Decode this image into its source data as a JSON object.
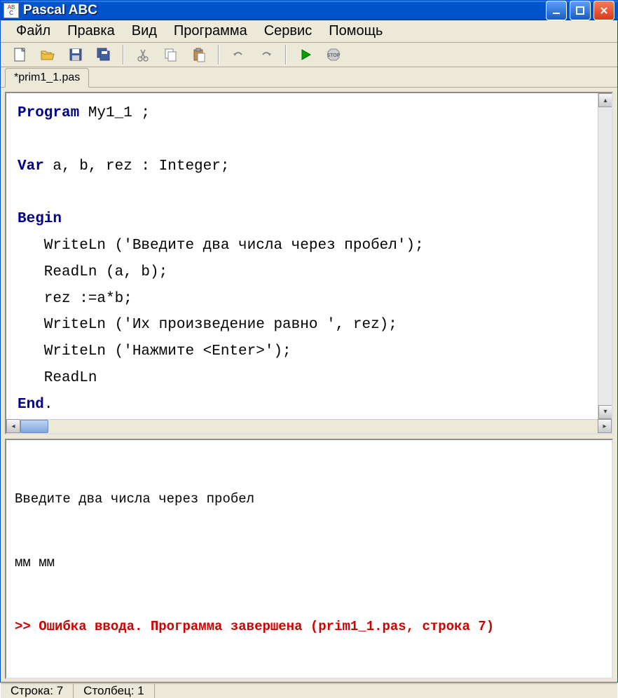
{
  "window": {
    "title": "Pascal ABC"
  },
  "menu": [
    "Файл",
    "Правка",
    "Вид",
    "Программа",
    "Сервис",
    "Помощь"
  ],
  "toolbar_icons": [
    "new-icon",
    "open-icon",
    "save-icon",
    "save-all-icon",
    "cut-icon",
    "copy-icon",
    "paste-icon",
    "undo-icon",
    "redo-icon",
    "run-icon",
    "stop-icon"
  ],
  "tabs": [
    "*prim1_1.pas"
  ],
  "code": {
    "lines": [
      {
        "segments": [
          {
            "t": "Program",
            "c": "kw"
          },
          {
            "t": " My1_1 ;",
            "c": ""
          }
        ]
      },
      {
        "segments": [
          {
            "t": "",
            "c": ""
          }
        ]
      },
      {
        "segments": [
          {
            "t": "Var",
            "c": "kw"
          },
          {
            "t": " a, b, rez : Integer;",
            "c": ""
          }
        ]
      },
      {
        "segments": [
          {
            "t": "",
            "c": ""
          }
        ]
      },
      {
        "segments": [
          {
            "t": "Begin",
            "c": "kw"
          }
        ]
      },
      {
        "segments": [
          {
            "t": "   WriteLn ('Введите два числа через пробел');",
            "c": ""
          }
        ]
      },
      {
        "segments": [
          {
            "t": "   ReadLn (a, b);",
            "c": ""
          }
        ]
      },
      {
        "segments": [
          {
            "t": "   rez :=a*b;",
            "c": ""
          }
        ]
      },
      {
        "segments": [
          {
            "t": "   WriteLn ('Их произведение равно ', rez);",
            "c": ""
          }
        ]
      },
      {
        "segments": [
          {
            "t": "   WriteLn ('Нажмите <Enter>');",
            "c": ""
          }
        ]
      },
      {
        "segments": [
          {
            "t": "   ReadLn",
            "c": ""
          }
        ]
      },
      {
        "segments": [
          {
            "t": "End",
            "c": "kw"
          },
          {
            "t": ".",
            "c": ""
          }
        ]
      }
    ]
  },
  "output": {
    "line1": "Введите два числа через пробел",
    "line2": "мм мм",
    "error_prefix": ">> ",
    "error": "Ошибка ввода. Программа завершена (prim1_1.pas, строка 7)"
  },
  "status": {
    "row_label": "Строка:",
    "row": "7",
    "col_label": "Столбец:",
    "col": "1"
  }
}
